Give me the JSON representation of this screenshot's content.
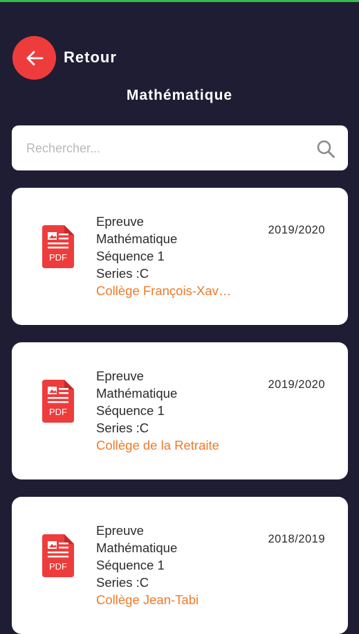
{
  "header": {
    "back_label": "Retour",
    "title": "Mathématique"
  },
  "search": {
    "placeholder": "Rechercher...",
    "value": ""
  },
  "items": [
    {
      "line1": "Epreuve",
      "line2": "Mathématique",
      "line3": "Séquence 1",
      "line4": "Series :C",
      "school": "Collège François-Xav…",
      "year": "2019/2020",
      "icon": "pdf-file-icon"
    },
    {
      "line1": "Epreuve",
      "line2": "Mathématique",
      "line3": "Séquence 1",
      "line4": "Series :C",
      "school": "Collège de la Retraite",
      "year": "2019/2020",
      "icon": "pdf-file-icon"
    },
    {
      "line1": "Epreuve",
      "line2": "Mathématique",
      "line3": "Séquence 1",
      "line4": "Series :C",
      "school": "Collège Jean-Tabi",
      "year": "2018/2019",
      "icon": "pdf-file-icon"
    }
  ],
  "colors": {
    "background": "#1f1d34",
    "accent_red": "#ee3c3c",
    "school_orange": "#f07a28",
    "status_green": "#2fbf4a"
  }
}
